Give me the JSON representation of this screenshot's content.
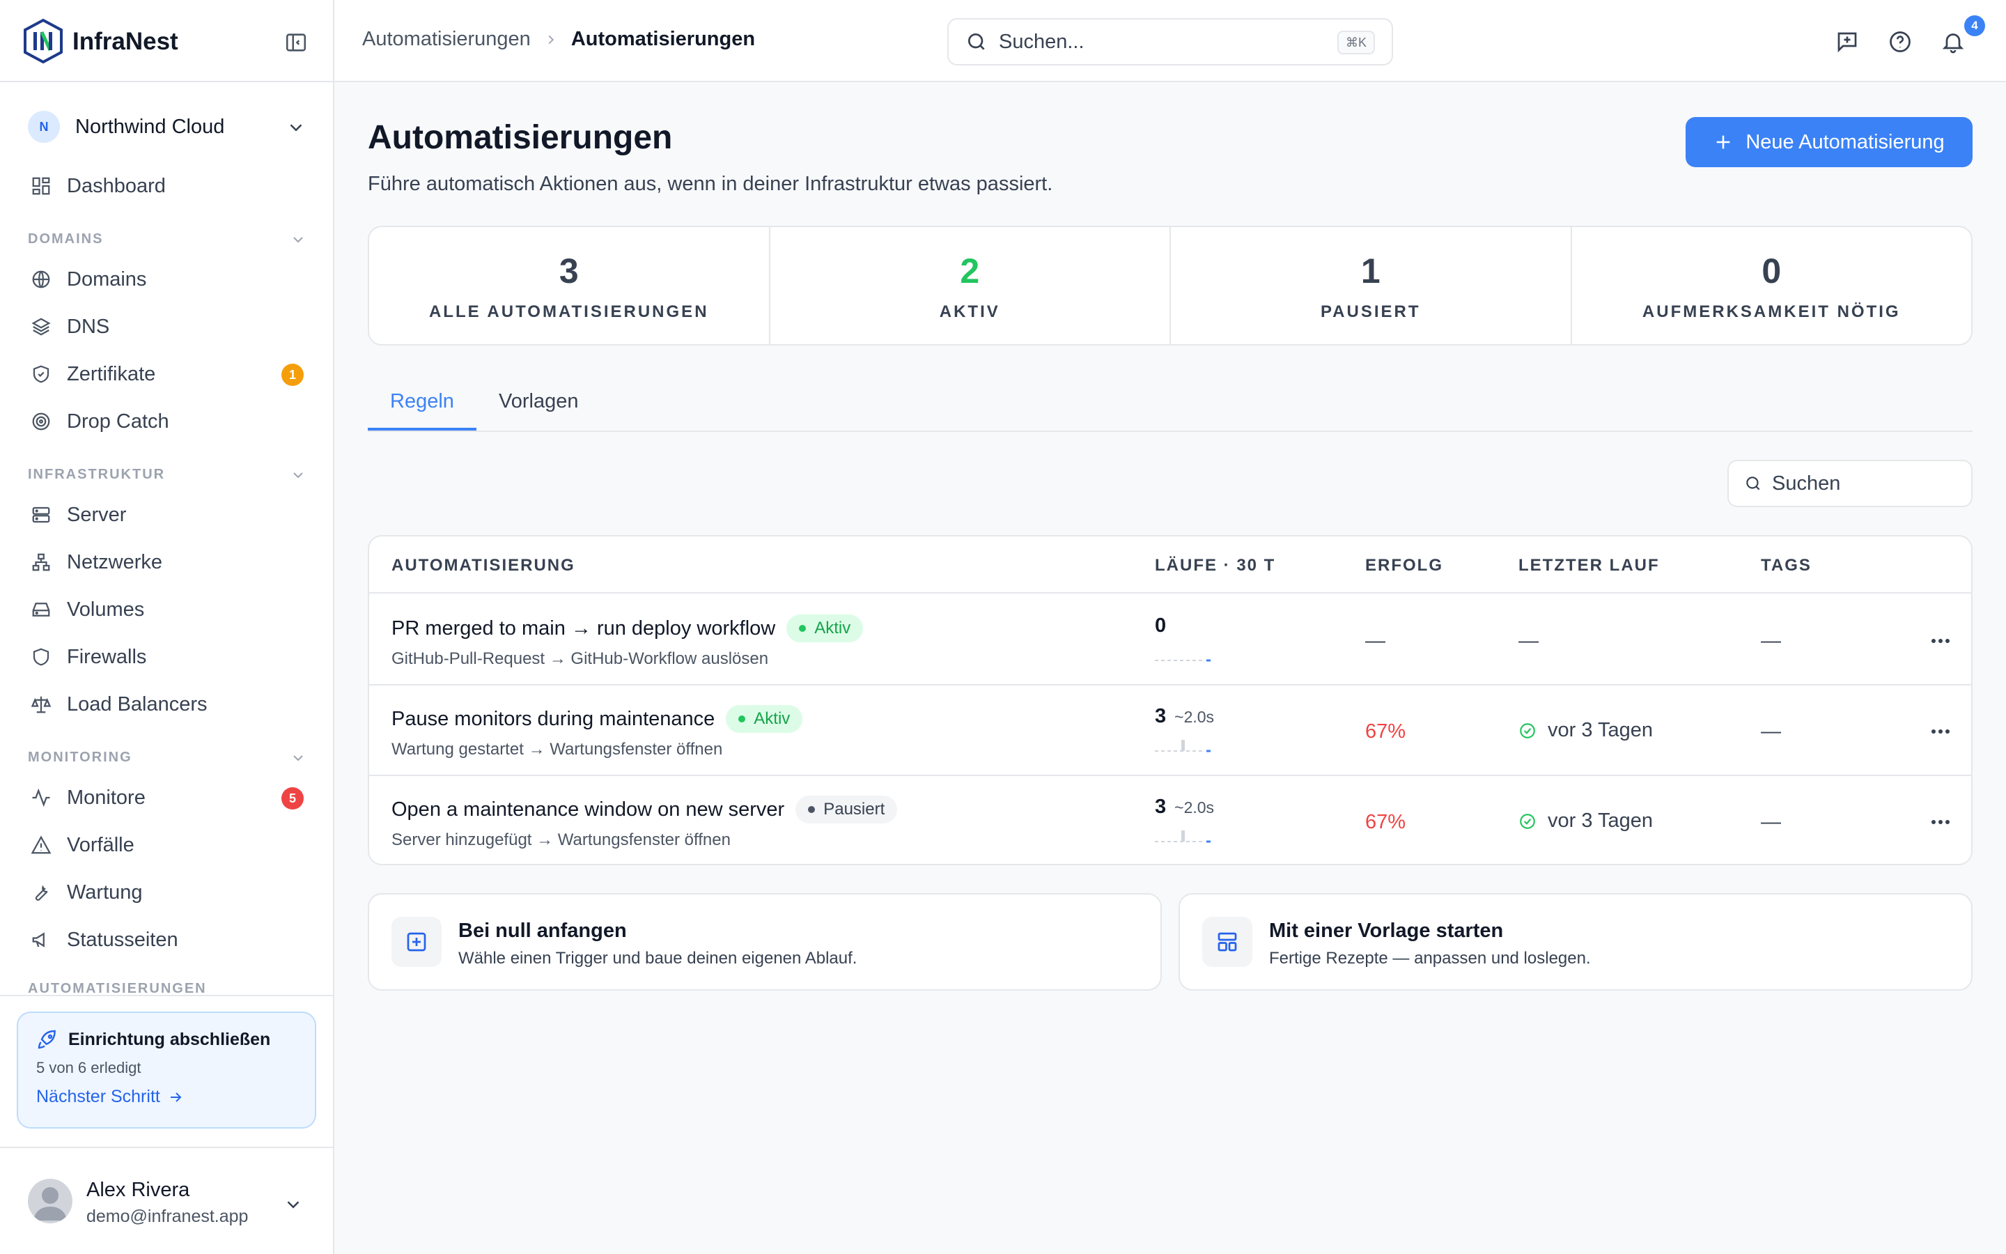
{
  "brand": {
    "name": "InfraNest"
  },
  "org": {
    "initial": "N",
    "name": "Northwind Cloud"
  },
  "nav": {
    "dashboard": "Dashboard",
    "sections": {
      "domains": "DOMAINS",
      "infrastructure": "INFRASTRUKTUR",
      "monitoring": "MONITORING",
      "automation": "AUTOMATISIERUNGEN"
    },
    "domains": [
      {
        "label": "Domains",
        "icon": "globe-icon"
      },
      {
        "label": "DNS",
        "icon": "layers-icon"
      },
      {
        "label": "Zertifikate",
        "icon": "shield-check-icon",
        "badge": "1"
      },
      {
        "label": "Drop Catch",
        "icon": "target-icon"
      }
    ],
    "infrastructure": [
      {
        "label": "Server",
        "icon": "server-icon"
      },
      {
        "label": "Netzwerke",
        "icon": "network-icon"
      },
      {
        "label": "Volumes",
        "icon": "hard-drive-icon"
      },
      {
        "label": "Firewalls",
        "icon": "shield-icon"
      },
      {
        "label": "Load Balancers",
        "icon": "scale-icon"
      }
    ],
    "monitoring": [
      {
        "label": "Monitore",
        "icon": "activity-icon",
        "badge": "5"
      },
      {
        "label": "Vorfälle",
        "icon": "alert-triangle-icon"
      },
      {
        "label": "Wartung",
        "icon": "wrench-icon"
      },
      {
        "label": "Statusseiten",
        "icon": "megaphone-icon"
      }
    ]
  },
  "setup": {
    "title": "Einrichtung abschließen",
    "progress": "5 von 6 erledigt",
    "link": "Nächster Schritt"
  },
  "user": {
    "name": "Alex Rivera",
    "email": "demo@infranest.app"
  },
  "topbar": {
    "breadcrumb": [
      "Automatisierungen",
      "Automatisierungen"
    ],
    "search_placeholder": "Suchen...",
    "shortcut": "⌘K",
    "notifications": "4"
  },
  "page": {
    "title": "Automatisierungen",
    "subtitle": "Führe automatisch Aktionen aus, wenn in deiner Infrastruktur etwas passiert.",
    "new_button": "Neue Automatisierung"
  },
  "stats": [
    {
      "value": "3",
      "label": "ALLE AUTOMATISIERUNGEN",
      "color": "#374151"
    },
    {
      "value": "2",
      "label": "AKTIV",
      "color": "#22c55e"
    },
    {
      "value": "1",
      "label": "PAUSIERT",
      "color": "#374151"
    },
    {
      "value": "0",
      "label": "AUFMERKSAMKEIT NÖTIG",
      "color": "#374151"
    }
  ],
  "tabs": [
    "Regeln",
    "Vorlagen"
  ],
  "list_search_placeholder": "Suchen",
  "table": {
    "headers": [
      "AUTOMATISIERUNG",
      "LÄUFE · 30 T",
      "ERFOLG",
      "LETZTER LAUF",
      "TAGS"
    ],
    "rows": [
      {
        "title": "PR merged to main → run deploy workflow",
        "status": "Aktiv",
        "status_kind": "active",
        "subtitle": "GitHub-Pull-Request → GitHub-Workflow auslösen",
        "runs": "0",
        "duration": "",
        "success": "—",
        "last_run": "—",
        "tags": "—"
      },
      {
        "title": "Pause monitors during maintenance",
        "status": "Aktiv",
        "status_kind": "active",
        "subtitle": "Wartung gestartet → Wartungsfenster öffnen",
        "runs": "3",
        "duration": "~2.0s",
        "success": "67%",
        "last_run": "vor 3 Tagen",
        "tags": "—"
      },
      {
        "title": "Open a maintenance window on new server",
        "status": "Pausiert",
        "status_kind": "paused",
        "subtitle": "Server hinzugefügt → Wartungsfenster öffnen",
        "runs": "3",
        "duration": "~2.0s",
        "success": "67%",
        "last_run": "vor 3 Tagen",
        "tags": "—"
      }
    ]
  },
  "cta": [
    {
      "title": "Bei null anfangen",
      "subtitle": "Wähle einen Trigger und baue deinen eigenen Ablauf."
    },
    {
      "title": "Mit einer Vorlage starten",
      "subtitle": "Fertige Rezepte — anpassen und loslegen."
    }
  ],
  "colors": {
    "accent": "#3b82f6",
    "success": "#22c55e",
    "danger": "#ef4444",
    "warning": "#f59e0b"
  }
}
